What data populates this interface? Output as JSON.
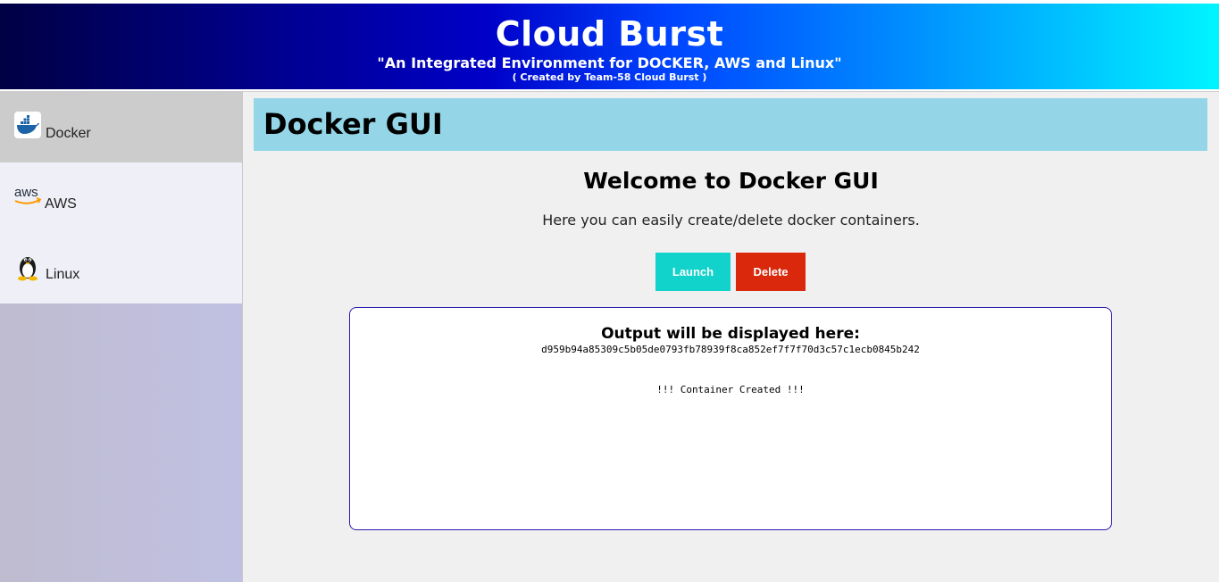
{
  "header": {
    "title": "Cloud Burst",
    "subtitle": "\"An Integrated Environment for DOCKER, AWS and Linux\"",
    "credit": "( Created by Team-58 Cloud Burst )"
  },
  "sidebar": {
    "items": [
      {
        "label": "Docker",
        "icon": "docker-whale-icon",
        "active": true
      },
      {
        "label": "AWS",
        "icon": "aws-logo-icon",
        "icon_text": "aws"
      },
      {
        "label": "Linux",
        "icon": "tux-penguin-icon"
      }
    ]
  },
  "main": {
    "page_title": "Docker GUI",
    "welcome": "Welcome to Docker GUI",
    "description": "Here you can easily create/delete docker containers.",
    "launch_label": "Launch",
    "delete_label": "Delete",
    "output": {
      "title": "Output will be displayed here:",
      "container_id": "d959b94a85309c5b05de0793fb78939f8ca852ef7f7f70d3c57c1ecb0845b242",
      "message": "!!! Container Created !!!"
    }
  },
  "colors": {
    "launch": "#12d3cb",
    "delete": "#d9280c",
    "banner": "#94d6e8",
    "output_border": "#2a1ab0"
  }
}
